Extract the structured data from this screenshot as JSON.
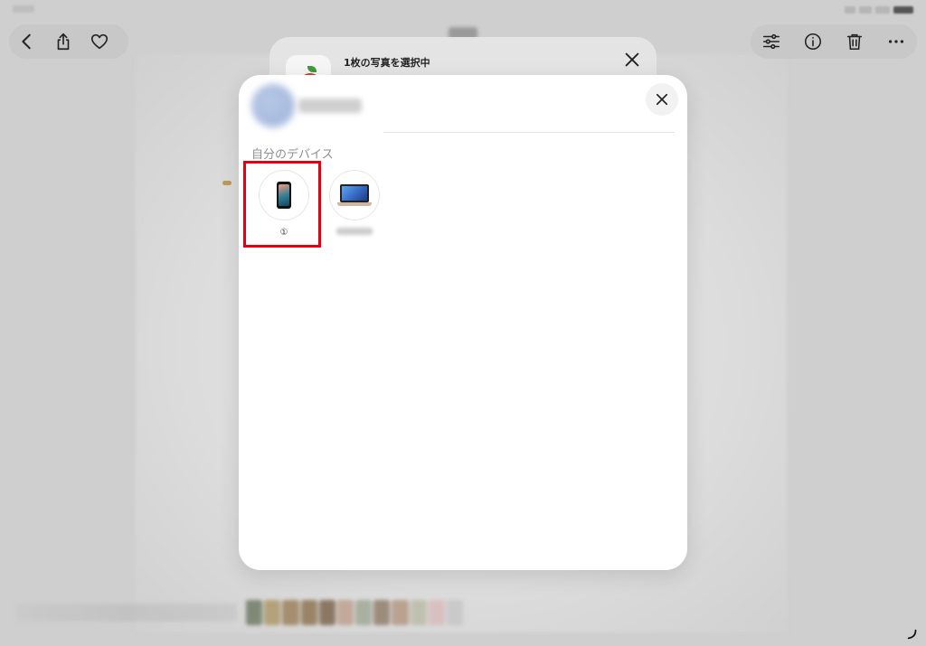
{
  "screen_title": "",
  "top_toolbar": {
    "left_icons": [
      "chevron-left-icon",
      "share-icon",
      "heart-icon"
    ],
    "right_icons": [
      "adjust-icon",
      "info-icon",
      "trash-icon",
      "more-icon"
    ]
  },
  "back_sheet": {
    "title": "1枚の写真を選択中",
    "app_icon": "app-icon"
  },
  "airdrop_sheet": {
    "section_label": "自分のデバイス",
    "devices": [
      {
        "label": "①",
        "icon": "iphone-icon",
        "highlighted": true
      },
      {
        "label": "",
        "icon": "macbook-icon",
        "highlighted": false
      }
    ],
    "highlight_color": "#e60012"
  },
  "colors": {
    "sheet_background": "#ffffff",
    "overlay": "#cfcfcf",
    "label_gray": "#8e8e93"
  }
}
